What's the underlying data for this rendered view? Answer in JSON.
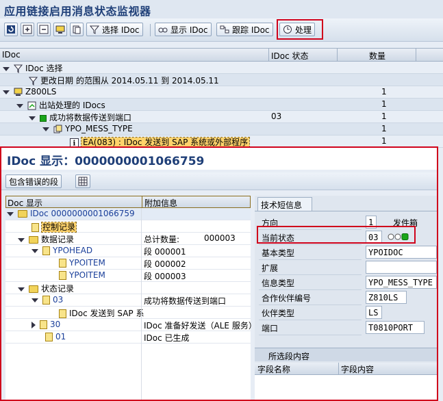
{
  "window": {
    "title": "应用链接启用消息状态监视器"
  },
  "toolbar": {
    "select_idoc": "选择 IDoc",
    "display_idoc": "显示 IDoc",
    "trace_idoc": "跟踪 IDoc",
    "process": "处理"
  },
  "grid": {
    "columns": {
      "idoc": "IDoc",
      "status": "IDoc 状态",
      "count": "数量"
    },
    "rows": [
      {
        "label": "IDoc 选择",
        "status": "",
        "count": ""
      },
      {
        "label": "更改日期 的范围从 2014.05.11 到 2014.05.11",
        "status": "",
        "count": ""
      },
      {
        "label": "Z800LS",
        "status": "",
        "count": "1"
      },
      {
        "label": "出站处理的 IDocs",
        "status": "",
        "count": "1"
      },
      {
        "label": "成功将数据传送到端口",
        "status": "03",
        "count": "1"
      },
      {
        "label": "YPO_MESS_TYPE",
        "status": "",
        "count": "1"
      },
      {
        "label": "EA(083) : IDoc 发送到 SAP 系统或外部程序",
        "status": "",
        "count": "1"
      }
    ]
  },
  "idoc_display": {
    "title": "IDoc 显示：0000000001066759",
    "seg_with_errors": "包含错误的段",
    "tree_header": {
      "doc": "Doc 显示",
      "info": "附加信息"
    },
    "tree": [
      {
        "label": "IDoc 0000000001066759",
        "info": ""
      },
      {
        "label": "控制记录",
        "info": ""
      },
      {
        "label": "数据记录",
        "info": "总计数量:",
        "info2": "000003"
      },
      {
        "label": "YPOHEAD",
        "info": "段 000001"
      },
      {
        "label": "YPOITEM",
        "info": "段 000002"
      },
      {
        "label": "YPOITEM",
        "info": "段 000003"
      },
      {
        "label": "状态记录",
        "info": ""
      },
      {
        "label": "03",
        "info": "成功将数据传送到端口"
      },
      {
        "label": "IDoc 发送到 SAP 系",
        "info": ""
      },
      {
        "label": "30",
        "info": "IDoc 准备好发送（ALE 服务）"
      },
      {
        "label": "01",
        "info": "IDoc 已生成"
      }
    ],
    "tech": {
      "tab": "技术短信息",
      "direction_label": "方向",
      "direction_value": "1",
      "direction_text": "发件箱",
      "current_status_label": "当前状态",
      "current_status_value": "03",
      "basic_type_label": "基本类型",
      "basic_type_value": "YPOIDOC",
      "extension_label": "扩展",
      "extension_value": "",
      "message_type_label": "信息类型",
      "message_type_value": "YPO_MESS_TYPE",
      "partner_no_label": "合作伙伴编号",
      "partner_no_value": "Z810LS",
      "partner_type_label": "伙伴类型",
      "partner_type_value": "LS",
      "port_label": "端口",
      "port_value": "T0810PORT"
    },
    "segment": {
      "title": "所选段内容",
      "col_field": "字段名称",
      "col_content": "字段内容"
    }
  },
  "colors": {
    "highlight": "#d0021b",
    "title_blue": "#1f3f78",
    "status_green": "#1aa51a"
  }
}
